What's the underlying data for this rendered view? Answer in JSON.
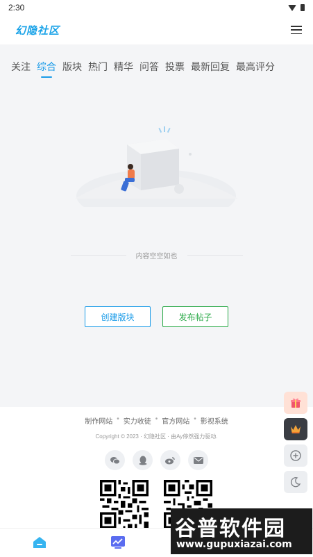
{
  "status_bar": {
    "time": "2:30"
  },
  "header": {
    "logo_text": "幻隐社区"
  },
  "tabs": [
    {
      "label": "关注"
    },
    {
      "label": "综合",
      "active": true
    },
    {
      "label": "版块"
    },
    {
      "label": "热门"
    },
    {
      "label": "精华"
    },
    {
      "label": "问答"
    },
    {
      "label": "投票"
    },
    {
      "label": "最新回复"
    },
    {
      "label": "最高评分"
    }
  ],
  "empty_state": {
    "text": "内容空空如也"
  },
  "actions": {
    "create_label": "创建版块",
    "post_label": "发布帖子"
  },
  "footer": {
    "links": [
      "制作网站",
      "实力收徒",
      "官方网站",
      "影视系统"
    ],
    "copyright": "Copyright © 2023 · 幻隐社区 · 由Ay停然强力驱动.",
    "social": [
      "wechat-icon",
      "qq-icon",
      "weibo-icon",
      "mail-icon"
    ]
  },
  "watermark": {
    "title": "谷普软件园",
    "url": "www.gupuxiazai.com"
  },
  "colors": {
    "accent": "#1a9be8",
    "post_green": "#27a845",
    "brand_logo": "#1aa3e8"
  }
}
